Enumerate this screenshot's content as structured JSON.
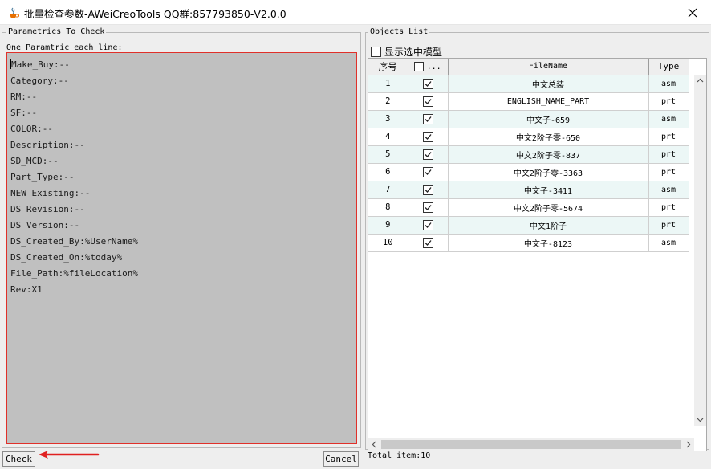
{
  "window": {
    "title": "批量检查参数-AWeiCreoTools QQ群:857793850-V2.0.0",
    "close_icon": "close-icon",
    "app_icon": "java-cup-icon"
  },
  "left": {
    "group_title": "Parametrics To Check",
    "subtitle": "One Paramtric each line:",
    "params": [
      "Make_Buy:--",
      "Category:--",
      "RM:--",
      "SF:--",
      "COLOR:--",
      "Description:--",
      "SD_MCD:--",
      "Part_Type:--",
      "NEW_Existing:--",
      "DS_Revision:--",
      "DS_Version:--",
      "DS_Created_By:%UserName%",
      "DS_Created_On:%today%",
      "File_Path:%fileLocation%",
      "Rev:X1"
    ],
    "check_label": "Check",
    "cancel_label": "Cancel"
  },
  "right": {
    "group_title": "Objects List",
    "show_selected_label": "显示选中模型",
    "columns": [
      "序号",
      "...",
      "FileName",
      "Type"
    ],
    "rows": [
      {
        "num": "1",
        "name": "中文总装",
        "type": "asm",
        "checked": true
      },
      {
        "num": "2",
        "name": "ENGLISH_NAME_PART",
        "type": "prt",
        "checked": true
      },
      {
        "num": "3",
        "name": "中文子-659",
        "type": "asm",
        "checked": true
      },
      {
        "num": "4",
        "name": "中文2阶子零-650",
        "type": "prt",
        "checked": true
      },
      {
        "num": "5",
        "name": "中文2阶子零-837",
        "type": "prt",
        "checked": true
      },
      {
        "num": "6",
        "name": "中文2阶子零-3363",
        "type": "prt",
        "checked": true
      },
      {
        "num": "7",
        "name": "中文子-3411",
        "type": "asm",
        "checked": true
      },
      {
        "num": "8",
        "name": "中文2阶子零-5674",
        "type": "prt",
        "checked": true
      },
      {
        "num": "9",
        "name": "中文1阶子",
        "type": "prt",
        "checked": true
      },
      {
        "num": "10",
        "name": "中文子-8123",
        "type": "asm",
        "checked": true
      }
    ],
    "total": "Total item:10"
  },
  "colors": {
    "param_bg": "#c0c0c0",
    "param_border": "#e0302a",
    "arrow": "#e02020",
    "row_alt": "#ecf7f6"
  }
}
